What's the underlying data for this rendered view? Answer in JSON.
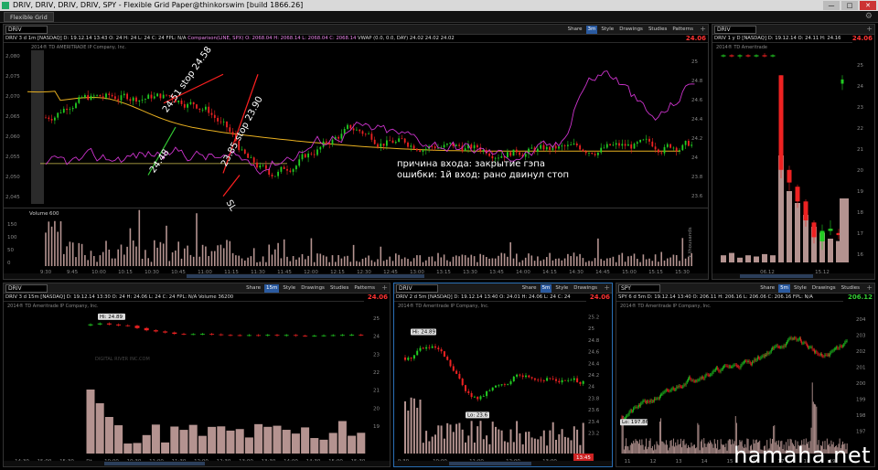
{
  "window": {
    "title": "DRIV, DRIV, DRIV, DRIV, SPY - Flexible Grid Paper@thinkorswim [build 1866.26]",
    "tab": "Flexible Grid",
    "buttons": [
      "—",
      "□",
      "✕"
    ]
  },
  "toolbar": {
    "share": "Share",
    "style": "Style",
    "drawings": "Drawings",
    "studies": "Studies",
    "patterns": "Patterns"
  },
  "main": {
    "symbol": "DRIV",
    "timeframe": "3m",
    "company": "DIGITAL RIVER INC.COM",
    "info_title": "DRIV 3 d 1m [NASDAQ]",
    "info_values": "D: 19.12.14 13:43  O: 24  H: 24  L: 24  C: 24",
    "fpl": "FPL: N/A",
    "comparison": "Comparison(LINE, SPX)  O: 2068.04  H: 2068.14  L: 2068.04  C: 2068.14",
    "vwap": "VWAP (0.0, 0.0, DAY)  24.02  24.02  24.02",
    "copyright": "2014® TD AMERITRADE IP Company, Inc.",
    "price": "24.06",
    "volume_label": "Volume",
    "volume_value": "600",
    "annotation_line1": "причина входа: закрытие гэпа",
    "annotation_line2": "ошибки: 1й вход: рано двинул стоп",
    "label_entry1": "24.48",
    "label_stop1": "24.51 stop 24.58",
    "label_stop2": "23.85 stop 23.90",
    "label_exit": "SL",
    "left_ticks": [
      "2,080",
      "2,075",
      "2,070",
      "2,065",
      "2,060",
      "2,055",
      "2,050",
      "2,045"
    ],
    "right_ticks": [
      "25",
      "24.8",
      "24.6",
      "24.4",
      "24.2",
      "24",
      "23.8",
      "23.6"
    ],
    "volume_ticks": [
      "150",
      "100",
      "50",
      "0"
    ],
    "volume_axis_label": "x thousands",
    "time_ticks": [
      "9:30",
      "9:45",
      "10:00",
      "10:15",
      "10:30",
      "10:45",
      "11:00",
      "11:15",
      "11:30",
      "11:45",
      "12:00",
      "12:15",
      "12:30",
      "12:45",
      "13:00",
      "13:15",
      "13:30",
      "13:45",
      "14:00",
      "14:15",
      "14:30",
      "14:45",
      "15:00",
      "15:15",
      "15:30"
    ]
  },
  "topright": {
    "symbol": "DRIV",
    "info": "DRIV 1 y D [NASDAQ]  D: 19.12.14  O: 24.11  H: 24.16",
    "price": "24.06",
    "copyright": "2014® TD Ameritrade",
    "ticks": [
      "25",
      "24",
      "23",
      "22",
      "21",
      "20",
      "19",
      "18",
      "17",
      "16"
    ],
    "time_ticks": [
      "06.12",
      "15.12"
    ]
  },
  "bottomleft": {
    "symbol": "DRIV",
    "timeframe": "15m",
    "info": "DRIV 3 d 15m [NASDAQ]  D: 19.12.14 13:30  O: 24  H: 24.06  L: 24  C: 24  FPL: N/A  Volume  36200",
    "company": "DIGITAL RIVER INC.COM",
    "copyright": "2014® TD Ameritrade IP Company, Inc.",
    "price": "24.06",
    "hi_label": "Hi: 24.89",
    "ticks": [
      "25",
      "24",
      "23",
      "22",
      "21",
      "20",
      "19"
    ],
    "time_ticks": [
      "14:30",
      "15:00",
      "15:30",
      "Dt",
      "10:00",
      "10:30",
      "11:00",
      "11:30",
      "12:00",
      "12:30",
      "13:00",
      "13:30",
      "14:00",
      "14:30",
      "15:00",
      "15:30"
    ]
  },
  "bottommid": {
    "symbol": "DRIV",
    "timeframe": "5m",
    "info": "DRIV 2 d 5m [NASDAQ]  D: 19.12.14 13:40  O: 24.01  H: 24.06  L: 24  C: 24",
    "copyright": "2014® TD Ameritrade IP Company, Inc.",
    "price": "24.06",
    "hi_label": "Hi: 24.89",
    "lo_label": "Lo: 23.6",
    "time_badge": "13:45",
    "ticks": [
      "25.2",
      "25",
      "24.8",
      "24.6",
      "24.4",
      "24.2",
      "24",
      "23.8",
      "23.6",
      "23.4",
      "23.2"
    ],
    "time_ticks": [
      "9:30",
      "10:00",
      "11:00",
      "12:00",
      "13:00"
    ]
  },
  "bottomright": {
    "symbol": "SPY",
    "timeframe": "5m",
    "info": "SPY 6 d 5m  D: 19.12.14 13:40  O: 206.11  H: 206.16  L: 206.06  C: 206.16  FPL: N/A",
    "copyright": "2014® TD Ameritrade IP Company, Inc.",
    "price": "206.12",
    "lo_label": "Lo: 197.86",
    "ticks": [
      "204",
      "203",
      "202",
      "201",
      "200",
      "199",
      "198",
      "197"
    ],
    "time_ticks": [
      "11",
      "12",
      "13",
      "14",
      "15",
      "16",
      "17",
      "18",
      "19"
    ]
  },
  "watermark": "hamaha.net",
  "colors": {
    "up": "#22cc22",
    "down": "#ee2222",
    "vwap": "#e8b020",
    "comparison": "#cc33cc",
    "volume": "#b49390",
    "annotation_line": "#ff2020",
    "entry_line": "#33cc33"
  }
}
